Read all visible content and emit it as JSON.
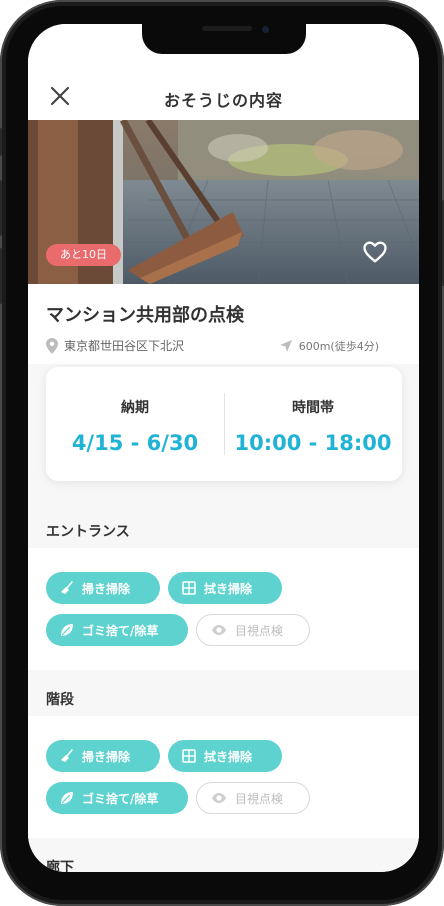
{
  "header": {
    "title": "おそうじの内容"
  },
  "hero": {
    "badge": "あと10日"
  },
  "job": {
    "title": "マンション共用部の点検",
    "location": "東京都世田谷区下北沢",
    "distance": "600m(徒歩4分)"
  },
  "card": {
    "deadline_label": "納期",
    "deadline_value": "4/15 - 6/30",
    "time_label": "時間帯",
    "time_value": "10:00 - 18:00"
  },
  "sections": [
    {
      "title": "エントランス",
      "tags": [
        {
          "label": "掃き掃除",
          "icon": "broom-icon",
          "active": true
        },
        {
          "label": "拭き掃除",
          "icon": "window-icon",
          "active": true
        },
        {
          "label": "ゴミ捨て/除草",
          "icon": "leaf-icon",
          "active": true
        },
        {
          "label": "目視点検",
          "icon": "eye-icon",
          "active": false
        }
      ]
    },
    {
      "title": "階段",
      "tags": [
        {
          "label": "掃き掃除",
          "icon": "broom-icon",
          "active": true
        },
        {
          "label": "拭き掃除",
          "icon": "window-icon",
          "active": true
        },
        {
          "label": "ゴミ捨て/除草",
          "icon": "leaf-icon",
          "active": true
        },
        {
          "label": "目視点検",
          "icon": "eye-icon",
          "active": false
        }
      ]
    },
    {
      "title": "廊下"
    }
  ],
  "colors": {
    "accent": "#20b3d6",
    "tag": "#5dd2cf",
    "badge": "#e96b6b"
  }
}
